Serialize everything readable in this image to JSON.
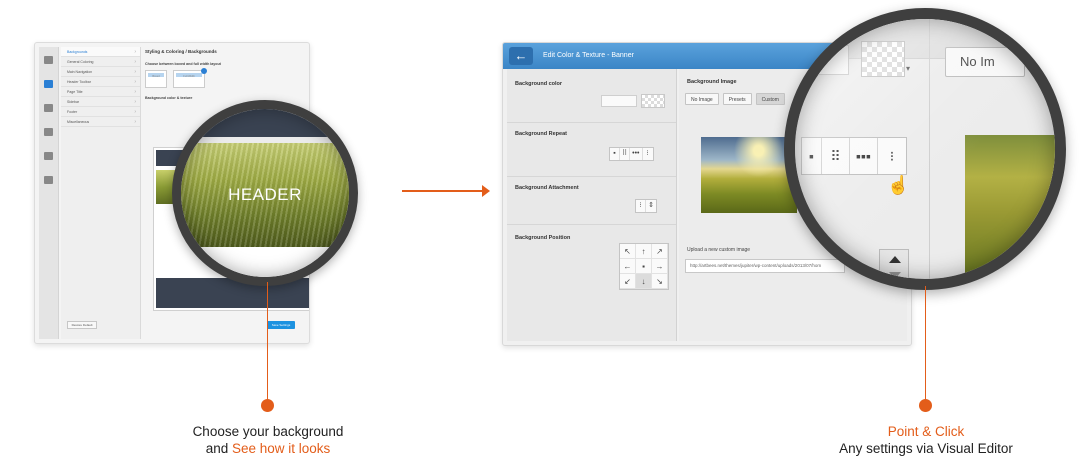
{
  "colors": {
    "accent": "#e35d1a",
    "primary_blue": "#3b85c6",
    "dark_panel": "#3a4352"
  },
  "left_window": {
    "sidebar_icons": [
      {
        "icon": "gear-icon",
        "label": ""
      },
      {
        "icon": "brush-icon",
        "label": ""
      },
      {
        "icon": "menu-icon",
        "label": ""
      },
      {
        "icon": "typography-icon",
        "label": ""
      },
      {
        "icon": "box-icon",
        "label": ""
      },
      {
        "icon": "photo-icon",
        "label": ""
      }
    ],
    "menu_items": [
      "Backgrounds",
      "General Coloring",
      "Main Navigation",
      "Header Toolbar",
      "Page Title",
      "Sidebar",
      "Footer",
      "Miscellaneous"
    ],
    "heading": "Styling & Coloring / Backgrounds",
    "sub1": "Choose between boxed and full width layout",
    "thumb1_caption": "Boxed",
    "thumb2_caption": "Full Width",
    "sub2": "Background color & texture",
    "restore_label": "Restore Default",
    "save_label": "Save Settings"
  },
  "left_magnifier": {
    "header_text": "HEADER"
  },
  "right_window": {
    "title": "Edit Color & Texture - Banner",
    "labels": {
      "bg_color": "Background color",
      "bg_repeat": "Background Repeat",
      "bg_attachment": "Background Attachment",
      "bg_position": "Background Position",
      "bg_image": "Background Image",
      "upload": "Upload a new custom image"
    },
    "image_tabs": [
      "No Image",
      "Presets",
      "Custom"
    ],
    "repeat_options": [
      "▪",
      "⠿",
      "•••",
      "⁝"
    ],
    "attachment_options": [
      "⁝",
      "⇕"
    ],
    "position_grid": [
      "↖",
      "↑",
      "↗",
      "←",
      "▪",
      "→",
      "↙",
      "↓",
      "↘"
    ],
    "custom_url": "http://artbees.net/themes/jupiter/wp-content/uploads/2013/07/hom"
  },
  "right_magnifier": {
    "no_image_label": "No Im",
    "repeat_options": [
      "▪",
      "⠿",
      "▪▪▪",
      "⁝"
    ]
  },
  "captions": {
    "left_line1": "Choose your background",
    "left_line2_prefix": "and ",
    "left_line2_accent": "See how it looks",
    "right_line1_accent": "Point & Click",
    "right_line2": "Any settings via Visual Editor"
  }
}
